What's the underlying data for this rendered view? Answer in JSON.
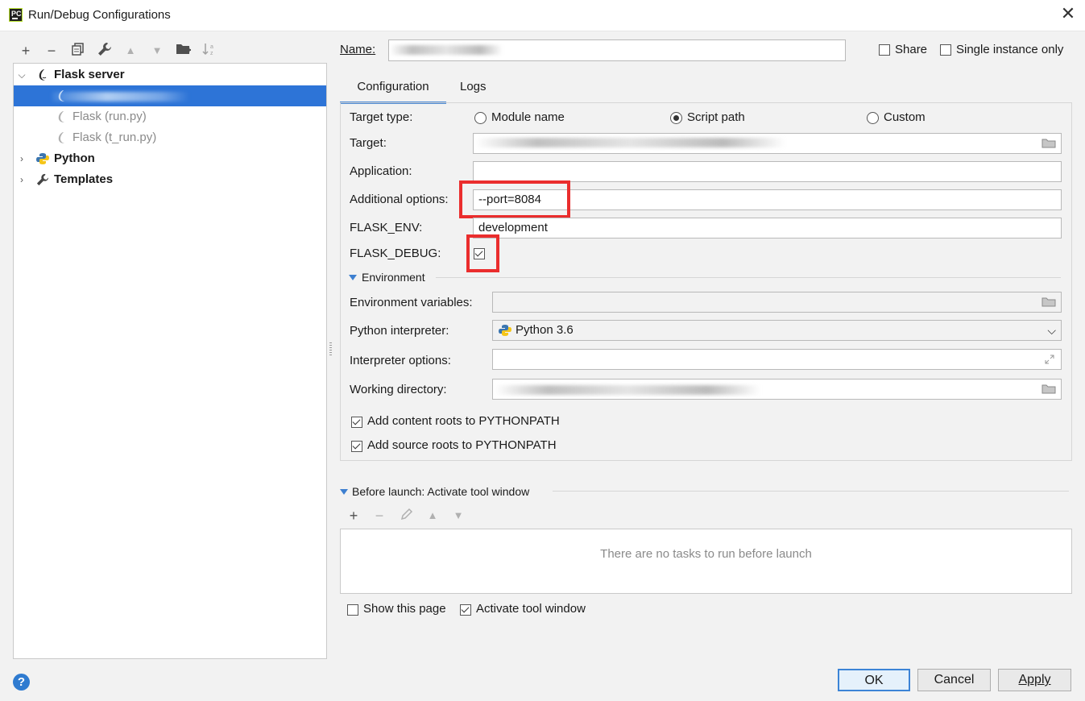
{
  "window": {
    "title": "Run/Debug Configurations",
    "app_icon_text": "PC"
  },
  "toolbar": {
    "icons": [
      "add-icon",
      "remove-icon",
      "copy-icon",
      "wrench-icon",
      "move-up-icon",
      "move-down-icon",
      "new-folder-icon",
      "sort-icon"
    ]
  },
  "tree": {
    "flask_server": "Flask server",
    "items": [
      {
        "label": "",
        "selected": true
      },
      {
        "label": "Flask (run.py)",
        "selected": false
      },
      {
        "label": "Flask (t_run.py)",
        "selected": false
      }
    ],
    "python": "Python",
    "templates": "Templates"
  },
  "header": {
    "name_label": "Name:",
    "name_value": "",
    "share_label": "Share",
    "share_checked": false,
    "single_instance_label": "Single instance only",
    "single_instance_checked": false
  },
  "tabs": {
    "configuration": "Configuration",
    "logs": "Logs",
    "active": "Configuration"
  },
  "config": {
    "target_type_label": "Target type:",
    "radio_module": "Module name",
    "radio_script": "Script path",
    "radio_custom": "Custom",
    "selected_target_type": "Script path",
    "target_label": "Target:",
    "target_value": "",
    "application_label": "Application:",
    "application_value": "",
    "additional_options_label": "Additional options:",
    "additional_options_value": "--port=8084",
    "flask_env_label": "FLASK_ENV:",
    "flask_env_value": "development",
    "flask_debug_label": "FLASK_DEBUG:",
    "flask_debug_checked": true,
    "environment_section": "Environment",
    "env_vars_label": "Environment variables:",
    "env_vars_value": "",
    "python_interpreter_label": "Python interpreter:",
    "python_interpreter_value": "Python 3.6",
    "interpreter_options_label": "Interpreter options:",
    "interpreter_options_value": "",
    "working_dir_label": "Working directory:",
    "working_dir_value": "",
    "add_content_roots_label": "Add content roots to PYTHONPATH",
    "add_content_roots_checked": true,
    "add_source_roots_label": "Add source roots to PYTHONPATH",
    "add_source_roots_checked": true
  },
  "before_launch": {
    "title": "Before launch: Activate tool window",
    "empty_text": "There are no tasks to run before launch",
    "show_this_page_label": "Show this page",
    "show_this_page_checked": false,
    "activate_tool_window_label": "Activate tool window",
    "activate_tool_window_checked": true
  },
  "buttons": {
    "ok": "OK",
    "cancel": "Cancel",
    "apply": "Apply",
    "help": "?"
  },
  "colors": {
    "selection": "#2d74d7",
    "highlight_red": "#ea2d2d",
    "tab_underline": "#4a88d4"
  }
}
